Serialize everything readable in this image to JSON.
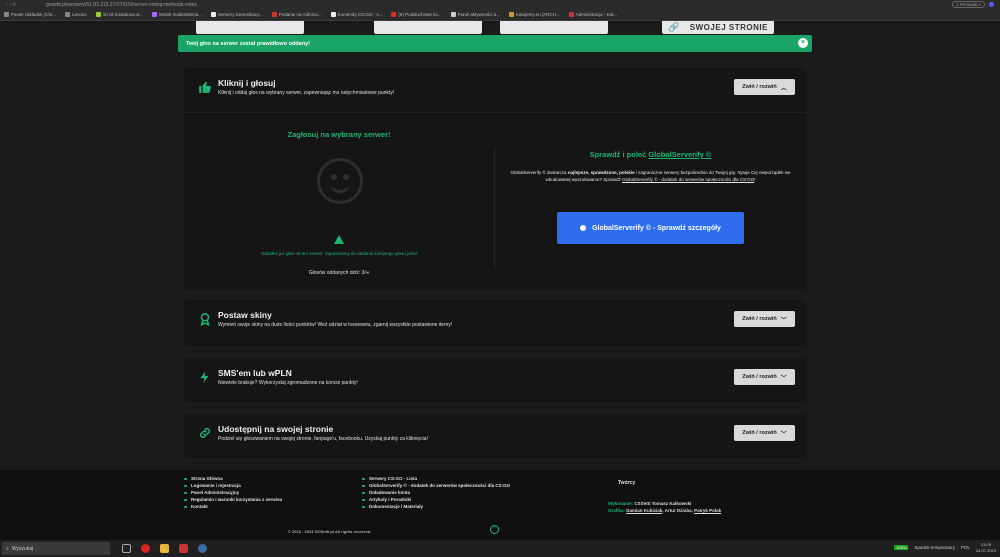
{
  "browser": {
    "url": "gosetti.pl/serwery/51.83.215.27/27015#server-voting-methods-votes",
    "bookmarks": [
      "Pasek zakładek (Chr...",
      "Lenovo",
      "10 nil meadama w...",
      "Widok modeslsteria...",
      "Serwery komunikacy...",
      "Podanie na Admina...",
      "Komendy CS:GO - s...",
      "(6) Podsłuchowe ko...",
      "Panel aktywności a...",
      "Katujemy.eu [ARCH...",
      "Administracja - Kat..."
    ],
    "ext_label": "2 PROBABLY"
  },
  "top_card": {
    "label": "SWOJEJ STRONIE"
  },
  "notice": {
    "text": "Twój głos na serwer został prawidłowo oddany!",
    "close": "×"
  },
  "sections": [
    {
      "title": "Kliknij i głosuj",
      "desc": "Kliknij i oddaj głos na wybrany serwer, zapewniając mu natychmiastowe punkty!",
      "toggle": "Zwiń / rozwiń",
      "toggle_icon": "chevron-up",
      "icon": "thumbs-up-icon"
    },
    {
      "title": "Postaw skiny",
      "desc": "Wymień swoje skiny na duże ilości punktów! Weź udział w losowaniu, zgarnij wszystkie postawione itemy!",
      "toggle": "Zwiń / rozwiń",
      "toggle_icon": "chevron-down",
      "icon": "award-icon"
    },
    {
      "title": "SMS'em lub wPLN",
      "desc": "Niewiele brakuje? Wykorzystaj zgromadzone na koncie punkty!",
      "toggle": "Zwiń / rozwiń",
      "toggle_icon": "chevron-down",
      "icon": "bolt-icon"
    },
    {
      "title": "Udostępnij na swojej stronie",
      "desc": "Podziel się głosowaniem na swojej stronie, fanpage'u, facebooku. Uzyskaj punkty za kliknięcia!",
      "toggle": "Zwiń / rozwiń",
      "toggle_icon": "chevron-down",
      "icon": "link-icon"
    }
  ],
  "vote": {
    "title": "Zagłosuj na wybrany serwer!",
    "message": "Oddałeś już głos na ten serwer. Zapraszamy do oddania kolejnego głosu jutro!",
    "count": "Głosów oddanych dziś: 3/∞"
  },
  "verify": {
    "title_prefix": "Sprawdź i poleć ",
    "title_link": "GlobalServerify ©",
    "text_1": "GlobalServerify © dostarcza ",
    "text_bold": "najlepsze, sprawdzone, polskie",
    "text_2": " i zagraniczne serwery bezpośrednio do Twojej gry. Irytuje Cię nieporządek we wbudowanej wyszukiwarce? Sprawdź ",
    "text_link": "GlobalServerify © - dodatek do serwerów społeczności dla CS:GO",
    "text_3": "!",
    "button": "GlobalServerify © - Sprawdź szczegóły"
  },
  "footer": {
    "col1": [
      "Strona Główna",
      "Logowanie i rejestracja",
      "Panel Administracyjny",
      "Regulamin i warunki korzystania z serwisu",
      "Kontakt"
    ],
    "col2": [
      "Serwery CS:GO - Lista",
      "GlobalServerify © - dodatek do serwerów społeczności dla CS:GO",
      "Doładowanie konta",
      "Artykuły i Poradniki",
      "Dokumentacje i Materiały"
    ],
    "creators_title": "Twórcy",
    "made_label": "Wykonanie:",
    "made_value": "CSSetti Tomasz Kalkowski",
    "gfx_label": "Grafika:",
    "gfx_1": "Damian Kubiziak",
    "gfx_2": ", Artur Dziuba, ",
    "gfx_3": "Patryk Polak",
    "copyright": "© 2016 - 2023 GOSetti.pl All rights reserved.",
    "up": "^"
  },
  "taskbar": {
    "search": "Wyszukaj",
    "battery": "100%",
    "weather": "Spadek temperatury",
    "lang": "POL",
    "time": "23:29",
    "date": "24.07.2023"
  }
}
